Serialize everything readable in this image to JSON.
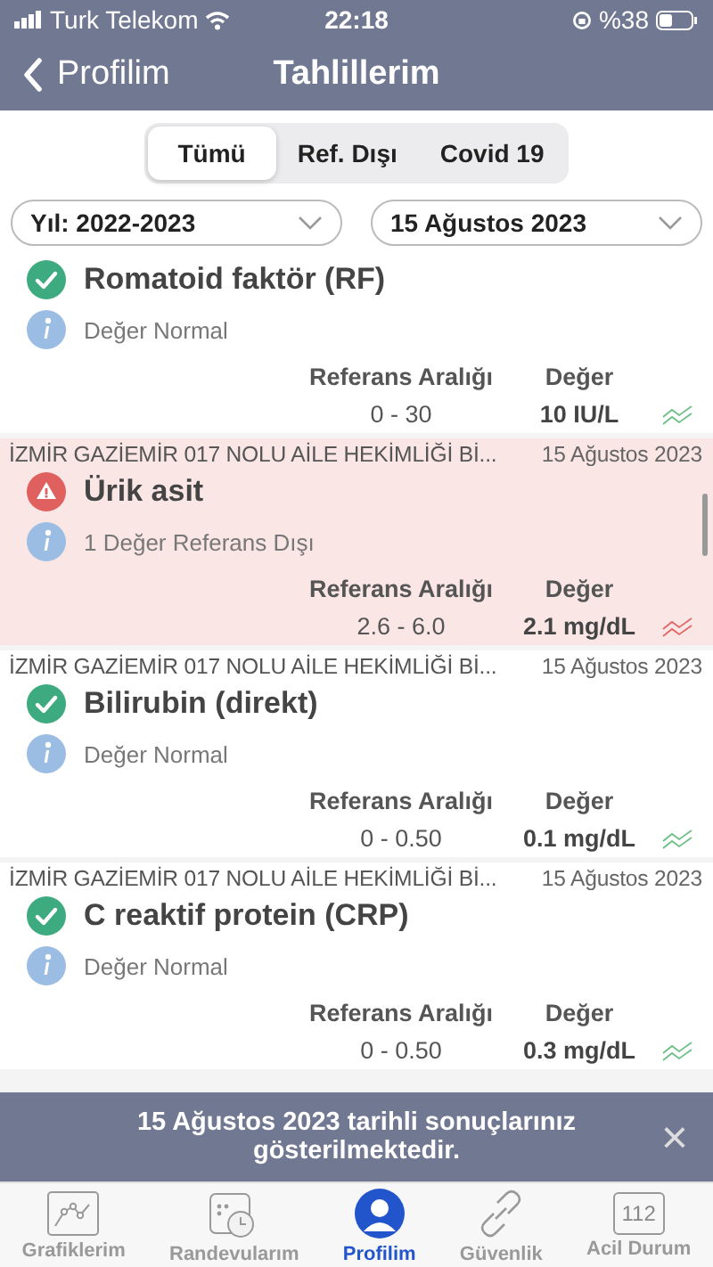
{
  "status_bar": {
    "carrier": "Turk Telekom",
    "time": "22:18",
    "battery": "%38"
  },
  "nav": {
    "back": "Profilim",
    "title": "Tahlillerim"
  },
  "segments": [
    {
      "label": "Tümü",
      "selected": true
    },
    {
      "label": "Ref. Dışı",
      "selected": false
    },
    {
      "label": "Covid 19",
      "selected": false
    }
  ],
  "filters": [
    {
      "value": "Yıl: 2022-2023"
    },
    {
      "value": "15 Ağustos 2023"
    }
  ],
  "results": [
    {
      "kind": "normal",
      "name": "Romatoid faktör (RF)",
      "info": "Değer Normal",
      "range_label": "Referans Aralığı",
      "value_label": "Değer",
      "range": "0 - 30",
      "value": "10 IU/L"
    },
    {
      "kind": "out",
      "source": "İZMİR GAZİEMİR 017 NOLU AİLE HEKİMLİĞİ Bİ...",
      "date": "15 Ağustos 2023",
      "name": "Ürik asit",
      "info": "1 Değer Referans Dışı",
      "range_label": "Referans Aralığı",
      "value_label": "Değer",
      "range": "2.6 - 6.0",
      "value": "2.1 mg/dL"
    },
    {
      "kind": "normal",
      "source": "İZMİR GAZİEMİR 017 NOLU AİLE HEKİMLİĞİ Bİ...",
      "date": "15 Ağustos 2023",
      "name": "Bilirubin (direkt)",
      "info": "Değer Normal",
      "range_label": "Referans Aralığı",
      "value_label": "Değer",
      "range": "0 - 0.50",
      "value": "0.1 mg/dL"
    },
    {
      "kind": "normal",
      "source": "İZMİR GAZİEMİR 017 NOLU AİLE HEKİMLİĞİ Bİ...",
      "date": "15 Ağustos 2023",
      "name": "C reaktif protein (CRP)",
      "info": "Değer Normal",
      "range_label": "Referans Aralığı",
      "value_label": "Değer",
      "range": "0 - 0.50",
      "value": "0.3 mg/dL"
    }
  ],
  "toast": {
    "message": "15 Ağustos 2023 tarihli sonuçlarınız gösterilmektedir.",
    "close": "×"
  },
  "tab_bar": [
    {
      "kind": "chart",
      "label": "Grafiklerim",
      "selected": false
    },
    {
      "kind": "calendar",
      "label": "Randevularım",
      "selected": false
    },
    {
      "kind": "person",
      "label": "Profilim",
      "selected": true
    },
    {
      "kind": "link",
      "label": "Güvenlik",
      "selected": false
    },
    {
      "kind": "emergency",
      "label": "Acil Durum",
      "badge": "112",
      "selected": false
    }
  ]
}
